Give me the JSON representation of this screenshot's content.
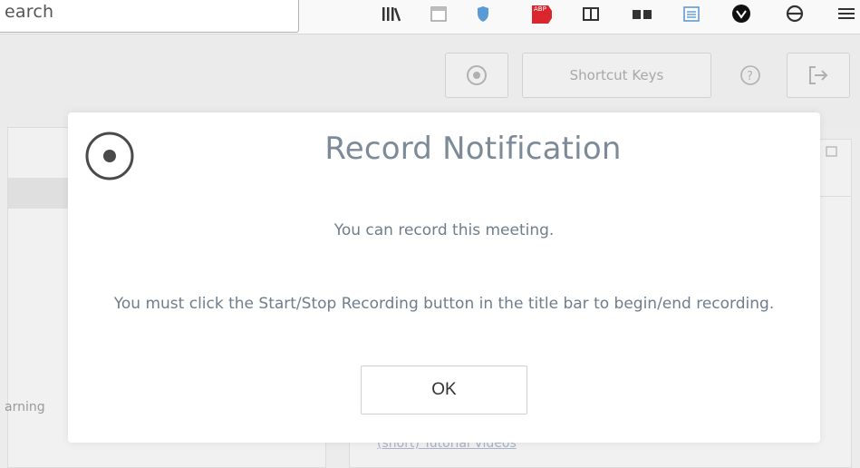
{
  "browser": {
    "search_text": "earch",
    "icons": [
      "library-icon",
      "reader-view-icon",
      "shield-icon",
      "adblock-icon",
      "sidebar-icon",
      "container-icon",
      "reader-list-icon",
      "wolfram-icon",
      "sync-icon",
      "menu-icon"
    ],
    "adblock_badge": "ABP"
  },
  "app": {
    "header": {
      "shortcut_keys_label": "Shortcut Keys"
    },
    "left_panel": {
      "partial_text": "arning"
    },
    "right_panel": {
      "partial_link": "(short) Tutorial Videos"
    }
  },
  "modal": {
    "title": "Record Notification",
    "line1": "You can record this meeting.",
    "line2": "You must click the Start/Stop Recording button in the title bar to begin/end recording.",
    "ok_label": "OK"
  },
  "colors": {
    "modal_text": "#6f7d8c",
    "title_text": "#7d8a98",
    "dim_background": "#ececec"
  }
}
